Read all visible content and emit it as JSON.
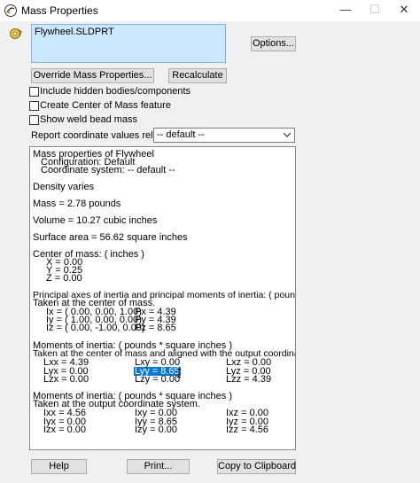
{
  "window": {
    "title": "Mass Properties",
    "controls": {
      "minimize": "—",
      "maximize": "☐",
      "close": "✕"
    }
  },
  "part_list": {
    "item": "Flywheel.SLDPRT"
  },
  "buttons": {
    "options": "Options...",
    "override": "Override Mass Properties...",
    "recalculate": "Recalculate",
    "help": "Help",
    "print": "Print...",
    "copy": "Copy to Clipboard"
  },
  "checkboxes": {
    "hidden_bodies": "Include hidden bodies/components",
    "center_of_mass": "Create Center of Mass feature",
    "weld_bead": "Show weld bead mass"
  },
  "report": {
    "label": "Report coordinate values relative to:",
    "selected": "-- default --"
  },
  "results": {
    "header": "Mass properties of Flywheel",
    "configuration": "Configuration: Default",
    "coordinate_system": "Coordinate system: -- default --",
    "density": "Density varies",
    "mass": "Mass = 2.78 pounds",
    "volume": "Volume = 10.27 cubic inches",
    "surface_area": "Surface area = 56.62 square inches",
    "com_title": "Center of mass: ( inches )",
    "com": [
      "X = 0.00",
      "Y = 0.25",
      "Z = 0.00"
    ],
    "principal_title": "Principal axes of inertia and principal moments of inertia: ( pounds * square inches )",
    "principal_sub": "Taken at the center of mass.",
    "principal_axes": [
      {
        "axis": "Ix = ( 0.00,  0.00,  1.00)",
        "moment": "Px = 4.39"
      },
      {
        "axis": "Iy = ( 1.00,  0.00,  0.00)",
        "moment": "Py = 4.39"
      },
      {
        "axis": "Iz = ( 0.00, -1.00,  0.00)",
        "moment": "Pz = 8.65"
      }
    ],
    "moi_com_title": "Moments of inertia: ( pounds * square inches )",
    "moi_com_sub": "Taken at the center of mass and aligned with the output coordinate system.",
    "moi_com": [
      [
        "Lxx = 4.39",
        "Lxy = 0.00",
        "Lxz = 0.00"
      ],
      [
        "Lyx = 0.00",
        "Lyy = 8.65",
        "Lyz = 0.00"
      ],
      [
        "Lzx = 0.00",
        "Lzy = 0.00",
        "Lzz = 4.39"
      ]
    ],
    "moi_out_title": "Moments of inertia: ( pounds * square inches )",
    "moi_out_sub": "Taken at the output coordinate system.",
    "moi_out": [
      [
        "Ixx = 4.56",
        "Ixy = 0.00",
        "Ixz = 0.00"
      ],
      [
        "Iyx = 0.00",
        "Iyy = 8.65",
        "Iyz = 0.00"
      ],
      [
        "Izx = 0.00",
        "Izy = 0.00",
        "Izz = 4.56"
      ]
    ]
  },
  "colors": {
    "selection": "#0078d7",
    "list_selection": "#cce8ff",
    "window_bg": "#f0f0f0"
  },
  "icons": [
    "app-icon",
    "part-icon",
    "dropdown-arrow-icon",
    "text-cursor-icon"
  ]
}
